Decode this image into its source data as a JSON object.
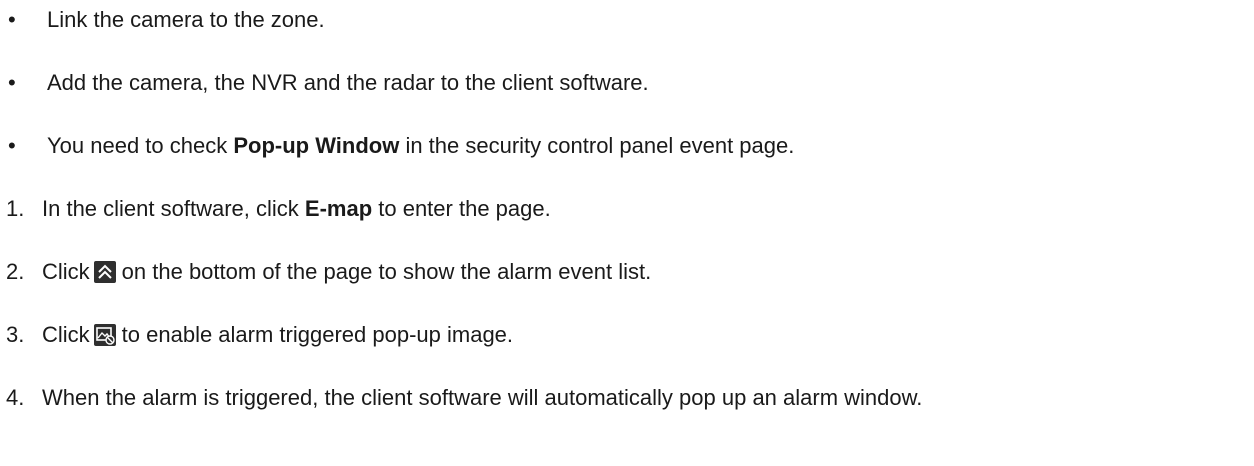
{
  "bullets": [
    {
      "marker": "•",
      "text": "Link the camera to the zone."
    },
    {
      "marker": "•",
      "text": "Add the camera, the NVR and the radar to the client software."
    },
    {
      "marker": "•",
      "pre": "You need to check ",
      "bold": "Pop-up Window",
      "post": " in the security control panel event page."
    }
  ],
  "steps": [
    {
      "marker": "1.",
      "pre": "In the client software, click ",
      "bold": "E-map",
      "post": " to enter the page."
    },
    {
      "marker": "2.",
      "pre": "Click",
      "icon": "double-chevron-up-icon",
      "post": "on the bottom of the page to show the alarm event list."
    },
    {
      "marker": "3.",
      "pre": "Click",
      "icon": "popup-image-icon",
      "post": "to enable alarm triggered pop-up image."
    },
    {
      "marker": "4.",
      "text": "When the alarm is triggered, the client software will automatically pop up an alarm window."
    }
  ]
}
